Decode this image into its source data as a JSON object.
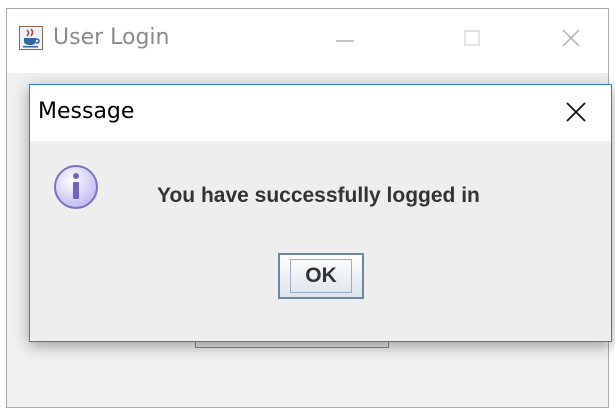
{
  "parent_window": {
    "title": "User Login",
    "icon": "java-cup-icon",
    "controls": [
      "minimize",
      "maximize",
      "close"
    ]
  },
  "dialog": {
    "title": "Message",
    "icon": "info-icon",
    "message": "You have successfully logged in",
    "ok_label": "OK"
  },
  "colors": {
    "dialog_border": "#2b7fd4",
    "info_icon_fill": "#d9d6f8",
    "info_icon_stroke": "#7a72c8",
    "ok_button_border": "#6a87a8"
  }
}
